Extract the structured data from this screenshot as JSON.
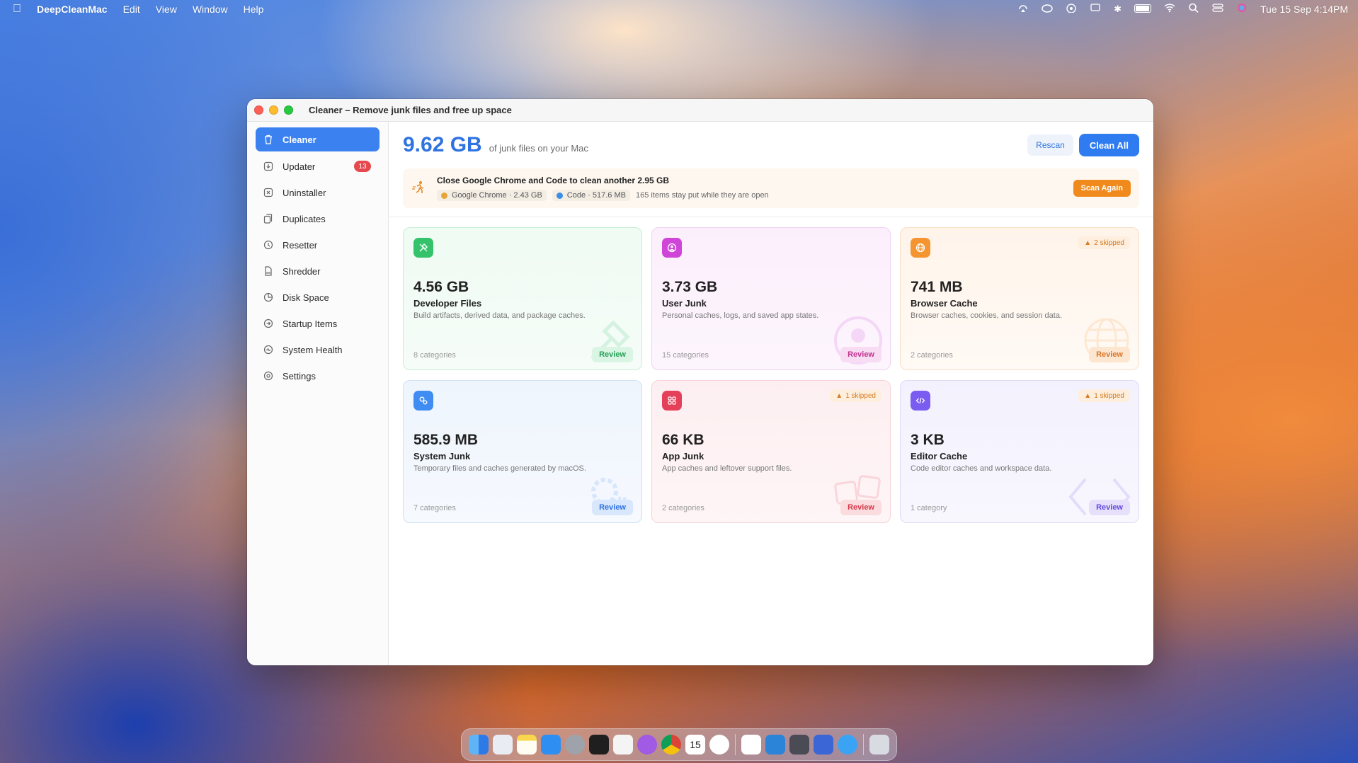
{
  "menubar": {
    "app_name": "DeepCleanMac",
    "menus": [
      "Edit",
      "View",
      "Window",
      "Help"
    ],
    "clock": "Tue 15 Sep  4:14PM"
  },
  "window": {
    "title": "Cleaner – Remove junk files and free up space"
  },
  "sidebar": {
    "items": [
      {
        "label": "Cleaner",
        "icon": "trash-icon",
        "active": true
      },
      {
        "label": "Updater",
        "icon": "update-icon",
        "badge": "13"
      },
      {
        "label": "Uninstaller",
        "icon": "uninstall-icon"
      },
      {
        "label": "Duplicates",
        "icon": "duplicates-icon"
      },
      {
        "label": "Resetter",
        "icon": "reset-icon"
      },
      {
        "label": "Shredder",
        "icon": "shredder-icon"
      },
      {
        "label": "Disk Space",
        "icon": "pie-icon"
      },
      {
        "label": "Startup Items",
        "icon": "startup-icon"
      },
      {
        "label": "System Health",
        "icon": "health-icon"
      },
      {
        "label": "Settings",
        "icon": "gear-icon"
      }
    ]
  },
  "header": {
    "total_size": "9.62 GB",
    "caption": "of junk files on your Mac",
    "rescan_label": "Rescan",
    "clean_all_label": "Clean All"
  },
  "notice": {
    "title": "Close Google Chrome and Code to clean another 2.95 GB",
    "chips": [
      {
        "label": "Google Chrome · 2.43 GB",
        "color": "#e7a43a"
      },
      {
        "label": "Code · 517.6 MB",
        "color": "#3a8ee6"
      }
    ],
    "note": "165 items stay put while they are open",
    "scan_again_label": "Scan Again"
  },
  "cards": [
    {
      "size": "4.56 GB",
      "name": "Developer Files",
      "desc": "Build artifacts, derived data, and package caches.",
      "count": "8 categories",
      "review": "Review",
      "skipped": ""
    },
    {
      "size": "3.73 GB",
      "name": "User Junk",
      "desc": "Personal caches, logs, and saved app states.",
      "count": "15 categories",
      "review": "Review",
      "skipped": ""
    },
    {
      "size": "741 MB",
      "name": "Browser Cache",
      "desc": "Browser caches, cookies, and session data.",
      "count": "2 categories",
      "review": "Review",
      "skipped": "2 skipped"
    },
    {
      "size": "585.9 MB",
      "name": "System Junk",
      "desc": "Temporary files and caches generated by macOS.",
      "count": "7 categories",
      "review": "Review",
      "skipped": ""
    },
    {
      "size": "66 KB",
      "name": "App Junk",
      "desc": "App caches and leftover support files.",
      "count": "2 categories",
      "review": "Review",
      "skipped": "1 skipped"
    },
    {
      "size": "3 KB",
      "name": "Editor Cache",
      "desc": "Code editor caches and workspace data.",
      "count": "1 category",
      "review": "Review",
      "skipped": "1 skipped"
    }
  ],
  "dock": {
    "calendar_day": "15"
  }
}
